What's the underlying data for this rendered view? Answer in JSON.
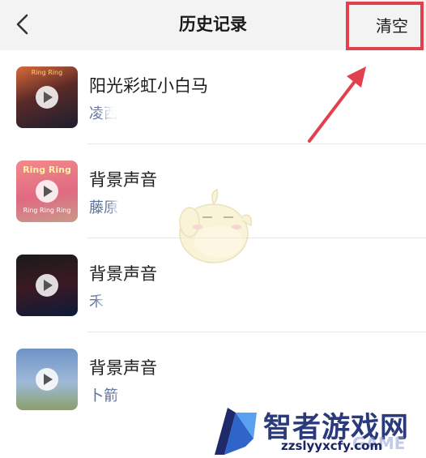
{
  "header": {
    "title": "历史记录",
    "clear_label": "清空",
    "back_icon": "chevron-left-icon"
  },
  "annotation": {
    "highlight_color": "#e0414d"
  },
  "history": {
    "items": [
      {
        "title": "阳光彩虹小白马",
        "artist": "凌西",
        "thumb_text_top": "Ring Ring",
        "thumb_text_bottom": ""
      },
      {
        "title": "背景声音",
        "artist": "藤原",
        "thumb_text_top": "Ring Ring",
        "thumb_text_bottom": "Ring Ring Ring"
      },
      {
        "title": "背景声音",
        "artist": "禾",
        "thumb_text_top": "",
        "thumb_text_bottom": ""
      },
      {
        "title": "背景声音",
        "artist": "卜箭",
        "thumb_text_top": "",
        "thumb_text_bottom": ""
      }
    ]
  },
  "watermark": {
    "name": "智者游戏网",
    "url": "zzslyyxcfy.com",
    "game_text": "GAME"
  }
}
